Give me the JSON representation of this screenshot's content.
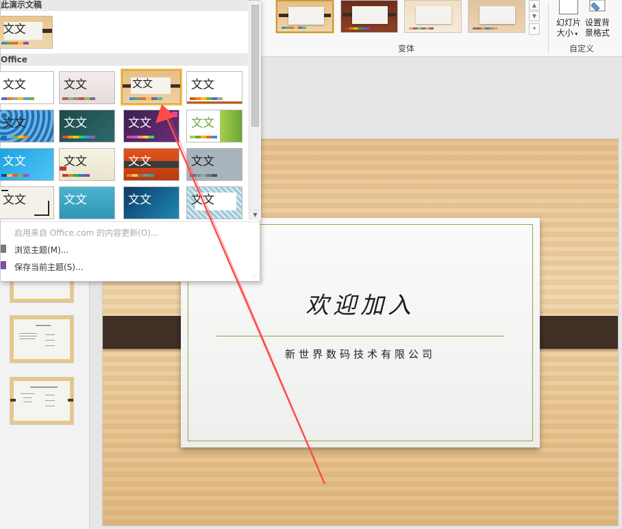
{
  "ribbon": {
    "variants_label": "变体",
    "custom_label": "自定义",
    "slide_size_label": [
      "幻灯片",
      "大小"
    ],
    "format_bg_label": [
      "设置背",
      "景格式"
    ]
  },
  "gallery": {
    "this_presentation_header": "此演示文稿",
    "office_header": "Office",
    "thumb_text": "文文",
    "menu": {
      "update": "启用来自 Office.com 的内容更新(O)...",
      "browse": "浏览主题(M)...",
      "save": "保存当前主题(S)..."
    }
  },
  "slide": {
    "title": "欢迎加入",
    "subtitle": "新世界数码技术有限公司"
  },
  "colors": {
    "accent_red": "#ff4b4b",
    "selection_gold": "#f5c44e"
  }
}
